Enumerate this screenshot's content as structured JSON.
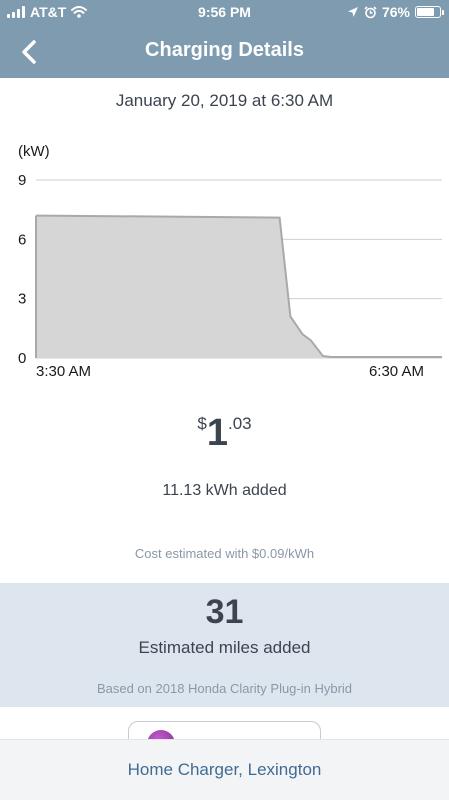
{
  "status_bar": {
    "carrier": "AT&T",
    "time": "9:56 PM",
    "battery": "76%",
    "battery_level": 0.76,
    "icons": [
      "signal-icon",
      "wifi-icon",
      "location-arrow-icon",
      "alarm-icon",
      "battery-icon"
    ]
  },
  "header": {
    "title": "Charging Details",
    "back_icon": "chevron-left-icon"
  },
  "session": {
    "date": "January 20, 2019 at 6:30 AM"
  },
  "chart_data": {
    "type": "area",
    "ylabel": "(kW)",
    "yticks": [
      "9",
      "6",
      "3",
      "0"
    ],
    "ylim": [
      0,
      9
    ],
    "xtick_labels": [
      "3:30 AM",
      "6:30 AM"
    ],
    "x_hours": [
      0,
      0.05,
      1.8,
      1.88,
      1.97,
      2.03,
      2.12,
      2.18,
      3.0
    ],
    "values_kw": [
      7.2,
      7.2,
      7.1,
      2.1,
      1.2,
      0.9,
      0.1,
      0.05,
      0.05
    ],
    "xlim_hours": [
      0,
      3.0
    ],
    "grid": true,
    "fill_color": "#d6d6d6",
    "line_color": "#a9a9a9"
  },
  "cost": {
    "currency": "$",
    "dollars": "1",
    "cents": ".03"
  },
  "energy": {
    "added": "11.13 kWh added",
    "rate_note": "Cost estimated with $0.09/kWh"
  },
  "miles": {
    "value": "31",
    "label": "Estimated miles added",
    "vehicle_note": "Based on 2018 Honda Clarity Plug-in Hybrid"
  },
  "colors": {
    "header_bg": "#7f9bb0",
    "panel_bg": "#dde6ef",
    "link": "#3f6c95"
  },
  "footer": {
    "location": "Home Charger, Lexington"
  }
}
